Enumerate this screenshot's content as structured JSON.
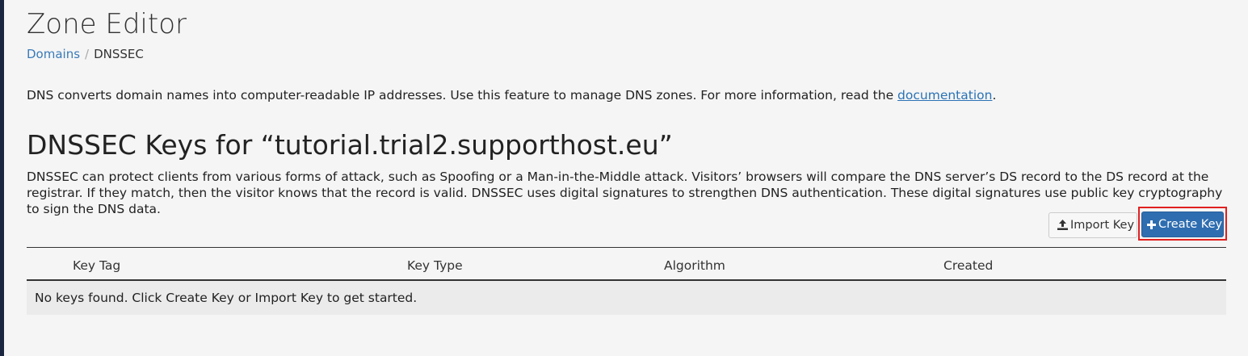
{
  "page": {
    "title": "Zone Editor"
  },
  "breadcrumb": {
    "link": "Domains",
    "separator": "/",
    "current": "DNSSEC"
  },
  "intro": {
    "text": "DNS converts domain names into computer-readable IP addresses. Use this feature to manage DNS zones. For more information, read the ",
    "link": "documentation",
    "suffix": "."
  },
  "section": {
    "heading": "DNSSEC Keys for “tutorial.trial2.supporthost.eu”",
    "description": "DNSSEC can protect clients from various forms of attack, such as Spoofing or a Man-in-the-Middle attack. Visitors’ browsers will compare the DNS server’s DS record to the DS record at the registrar. If they match, then the visitor knows that the record is valid. DNSSEC uses digital signatures to strengthen DNS authentication. These digital signatures use public key cryptography to sign the DNS data."
  },
  "toolbar": {
    "import_label": "Import Key",
    "import_icon": "upload-icon",
    "create_label": "Create Key",
    "create_icon": "plus-icon"
  },
  "table": {
    "columns": [
      "Key Tag",
      "Key Type",
      "Algorithm",
      "Created"
    ],
    "empty_message": "No keys found. Click Create Key or Import Key to get started."
  },
  "colors": {
    "accent": "#2e6db0",
    "highlight": "#e02020",
    "link": "#3a7ab8"
  }
}
